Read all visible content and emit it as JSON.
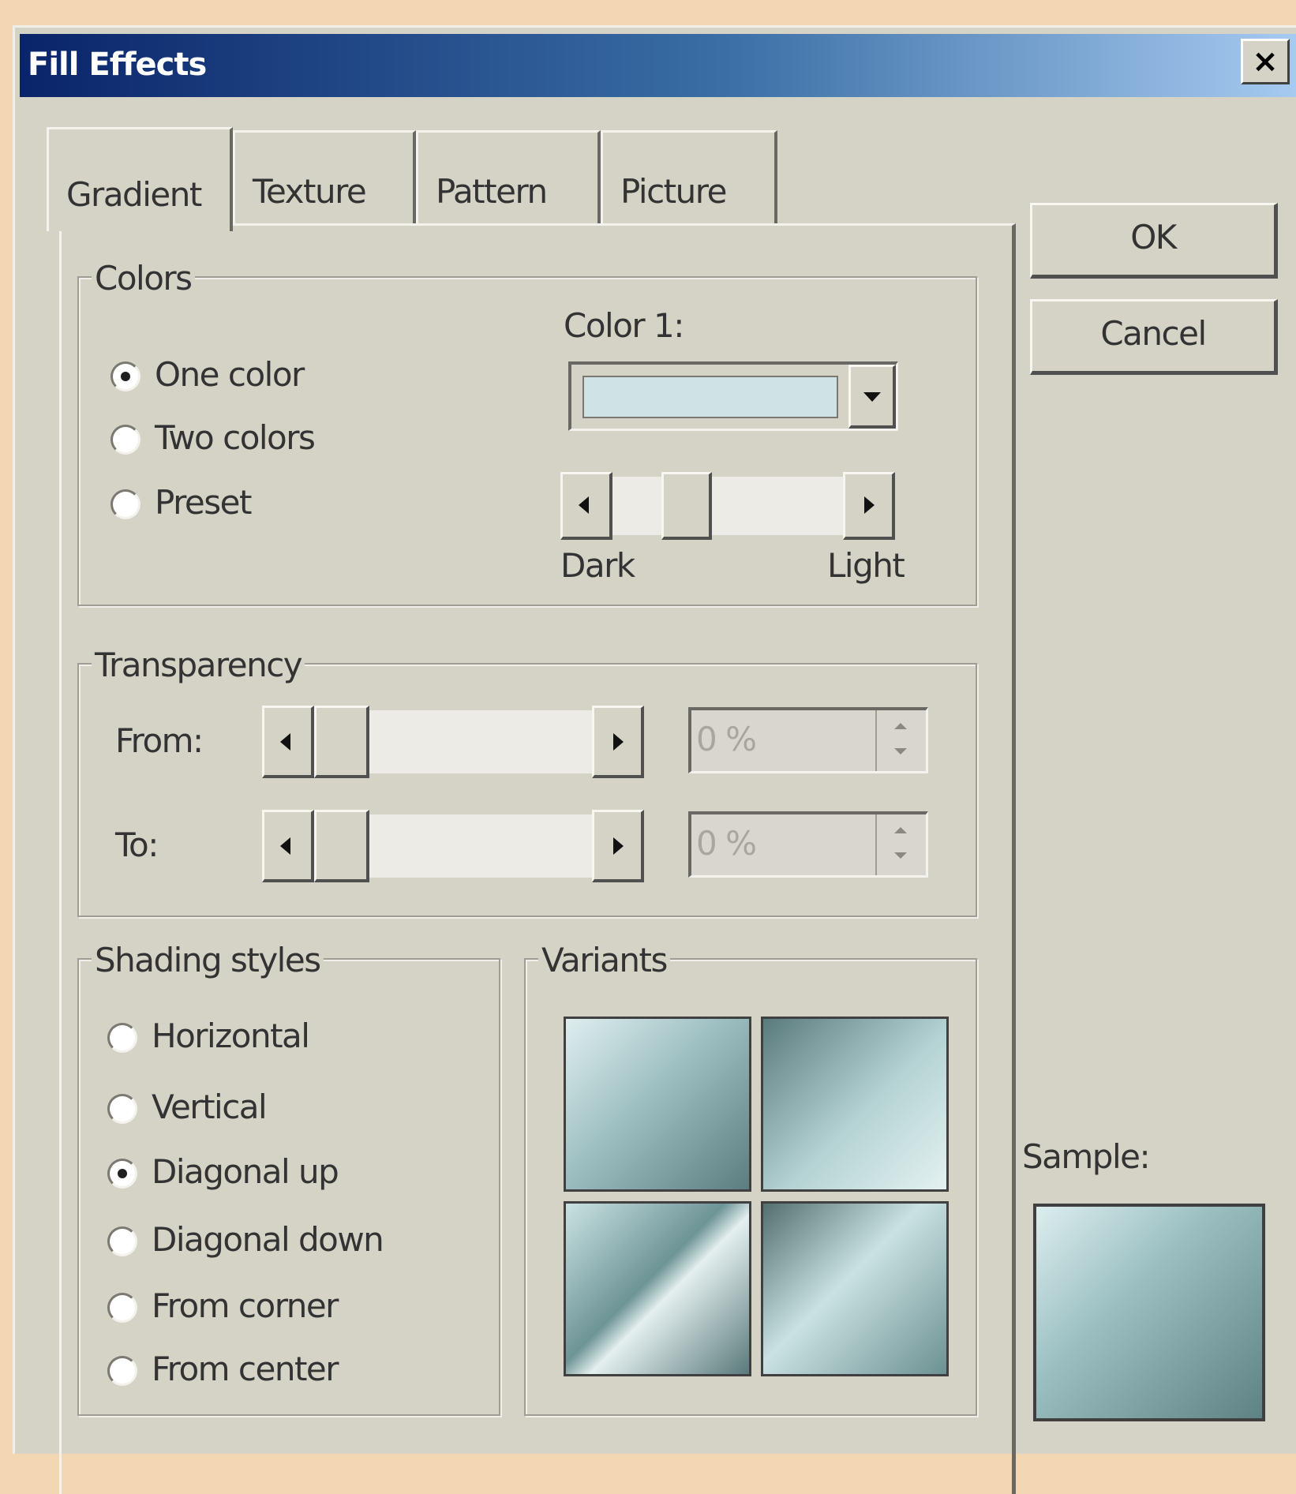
{
  "window": {
    "title": "Fill Effects",
    "close_label": "×"
  },
  "tabs": [
    {
      "label": "Gradient",
      "active": true
    },
    {
      "label": "Texture",
      "active": false
    },
    {
      "label": "Pattern",
      "active": false
    },
    {
      "label": "Picture",
      "active": false
    }
  ],
  "colors": {
    "group_label": "Colors",
    "options": [
      {
        "label": "One color",
        "selected": true
      },
      {
        "label": "Two colors",
        "selected": false
      },
      {
        "label": "Preset",
        "selected": false
      }
    ],
    "color1_label": "Color 1:",
    "color1_value": "#cfe2e6",
    "dark_label": "Dark",
    "light_label": "Light"
  },
  "transparency": {
    "group_label": "Transparency",
    "from_label": "From:",
    "to_label": "To:",
    "from_value": "0 %",
    "to_value": "0 %"
  },
  "shading": {
    "group_label": "Shading styles",
    "options": [
      {
        "label": "Horizontal",
        "selected": false
      },
      {
        "label": "Vertical",
        "selected": false
      },
      {
        "label": "Diagonal up",
        "selected": true
      },
      {
        "label": "Diagonal down",
        "selected": false
      },
      {
        "label": "From corner",
        "selected": false
      },
      {
        "label": "From center",
        "selected": false
      }
    ]
  },
  "variants": {
    "group_label": "Variants"
  },
  "buttons": {
    "ok": "OK",
    "cancel": "Cancel"
  },
  "sample_label": "Sample:"
}
